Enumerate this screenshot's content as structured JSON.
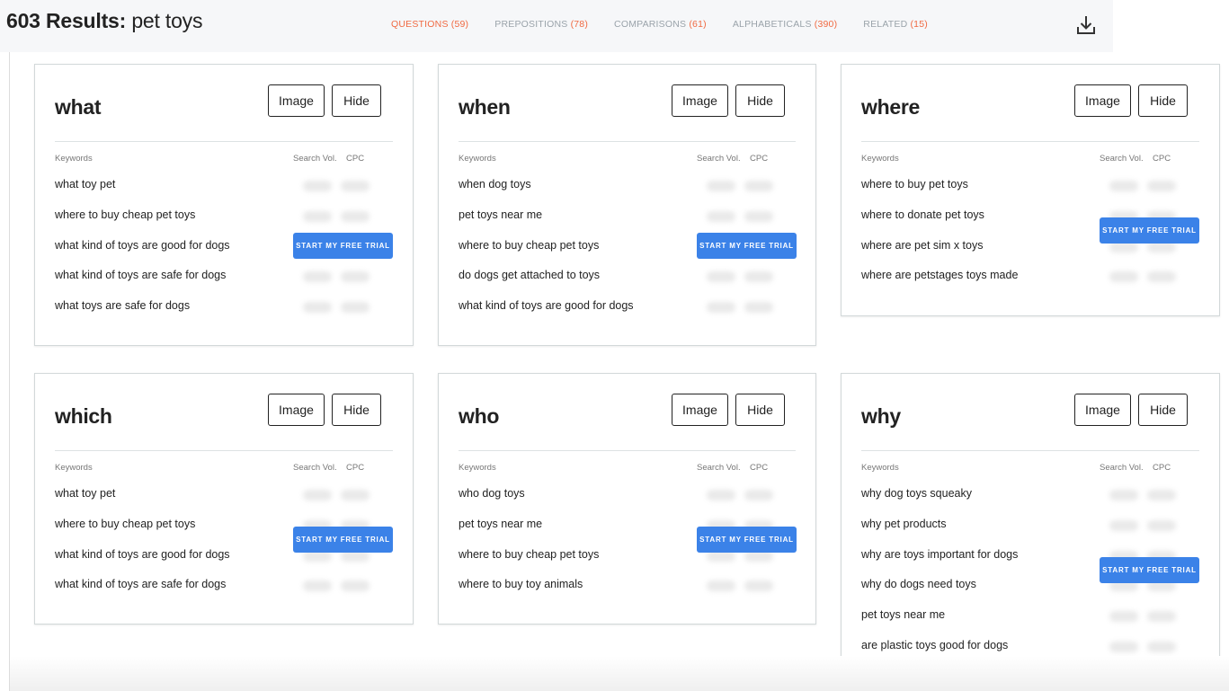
{
  "header": {
    "count_label": "603 Results:",
    "query": "pet toys",
    "tabs": [
      {
        "label": "QUESTIONS",
        "count": "(59)",
        "active": true
      },
      {
        "label": "PREPOSITIONS",
        "count": "(78)",
        "active": false
      },
      {
        "label": "COMPARISONS",
        "count": "(61)",
        "active": false
      },
      {
        "label": "ALPHABETICALS",
        "count": "(390)",
        "active": false
      },
      {
        "label": "RELATED",
        "count": "(15)",
        "active": false
      }
    ],
    "download_icon": "download-icon"
  },
  "colors": {
    "accent": "#f06a43",
    "tab_inactive": "#9aa3aa",
    "trial_button": "#3b82e8",
    "topbar_bg": "#f6f7f9"
  },
  "card_labels": {
    "image": "Image",
    "hide": "Hide",
    "keywords": "Keywords",
    "search_vol": "Search Vol.",
    "cpc": "CPC",
    "trial": "START MY FREE TRIAL"
  },
  "cards": [
    {
      "title": "what",
      "keywords": [
        "what toy pet",
        "where to buy cheap pet toys",
        "what kind of toys are good for dogs",
        "what kind of toys are safe for dogs",
        "what toys are safe for dogs"
      ]
    },
    {
      "title": "when",
      "keywords": [
        "when dog toys",
        "pet toys near me",
        "where to buy cheap pet toys",
        "do dogs get attached to toys",
        "what kind of toys are good for dogs"
      ]
    },
    {
      "title": "where",
      "keywords": [
        "where to buy pet toys",
        "where to donate pet toys",
        "where are pet sim x toys",
        "where are petstages toys made"
      ]
    },
    {
      "title": "which",
      "keywords": [
        "what toy pet",
        "where to buy cheap pet toys",
        "what kind of toys are good for dogs",
        "what kind of toys are safe for dogs"
      ]
    },
    {
      "title": "who",
      "keywords": [
        "who dog toys",
        "pet toys near me",
        "where to buy cheap pet toys",
        "where to buy toy animals"
      ]
    },
    {
      "title": "why",
      "keywords": [
        "why dog toys squeaky",
        "why pet products",
        "why are toys important for dogs",
        "why do dogs need toys",
        "pet toys near me",
        "are plastic toys good for dogs"
      ]
    }
  ]
}
